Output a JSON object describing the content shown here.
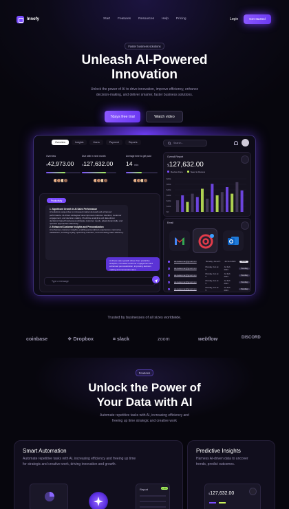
{
  "brand": {
    "name": "Innofy"
  },
  "nav": {
    "links": [
      "Start",
      "Features",
      "Resources",
      "Help",
      "Pricing"
    ],
    "login": "Login",
    "cta": "Get started"
  },
  "hero": {
    "eyebrow": "Faster business solutions",
    "title_line1": "Unleash AI-Powered",
    "title_line2": "Innovation",
    "subtitle_line1": "Unlock the power of AI to drive innovation, improve efficiency, enhance",
    "subtitle_line2": "decision-making, and deliver smarter, faster business solutions.",
    "primary_button": "7days free trial",
    "secondary_button": "Watch video"
  },
  "dashboard": {
    "tabs": [
      "Overview",
      "Insights",
      "Users",
      "Payment",
      "Reports"
    ],
    "search_placeholder": "Search...",
    "stats": [
      {
        "label": "Overview",
        "currency": "$",
        "value": "42,973.00",
        "progress": 0.55
      },
      {
        "label": "Due with in next month",
        "currency": "$",
        "value": "127,632.00",
        "progress": 0.7
      },
      {
        "label": "Average time to get paid",
        "currency": "",
        "value": "14",
        "unit": "min",
        "progress": 0.5
      }
    ],
    "chat": {
      "tag": "Productivity",
      "bot_heading1": "1. Significant Growth in AI Sales Performance",
      "bot_body1": "AI solutions surged due to increased market demand and enhanced performance. AI-driven strategies have improved customer retention, customer engagement, and decision-making. Predictive analytics and data-driven decisions helped businesses anticipate customer needs, adapt dynamically, and optimize approaches effectively.",
      "bot_heading2": "2. Enhanced Customer Insights and Personalization",
      "bot_body2": "AI enhances customer insights, enabling personalized experiences, improving satisfaction, boosting loyalty, optimizing retention, and increasing sales efficiency.",
      "user_msg": "Ai drives sales growth driven from predictive analytics, increased customer engagement and enhanced personalization, improving decision making and conversion rates.",
      "input_placeholder": "Type a message"
    },
    "report": {
      "title": "Overall Report",
      "currency": "$",
      "value": "127,632.00",
      "legend": [
        "Review Done",
        "Need to Review"
      ],
      "y_ticks": [
        "$60k",
        "$50k",
        "$40k",
        "$30k",
        "$20k",
        "$10k",
        "$0"
      ]
    },
    "email": {
      "title": "Email",
      "apps": [
        "gmail-icon",
        "mail-at-icon",
        "outlook-icon"
      ],
      "rows": [
        {
          "email": "alexsalesman@gmail.com",
          "time": "Monday, Jan at 5",
          "date": "Jul Feb 2024",
          "tag": "Done"
        },
        {
          "email": "alexsalesman@gmail.com",
          "time": "Monday, Jan at 5",
          "date": "Jul Feb 2024",
          "tag": "Pending"
        },
        {
          "email": "alexsalesman@gmail.com",
          "time": "Monday, Jan at 5",
          "date": "Jul Feb 2024",
          "tag": "Pending"
        },
        {
          "email": "alexsalesman@gmail.com",
          "time": "Monday, Jan at 5",
          "date": "Jul Feb 2024",
          "tag": "Pending"
        },
        {
          "email": "alexsalesman@gmail.com",
          "time": "Monday, Jan at 5",
          "date": "Jul Feb 2024",
          "tag": "Pending"
        }
      ]
    }
  },
  "trusted": {
    "text": "Trusted by businesses of all sizes worldwide.",
    "brands": [
      "coinbase",
      "Dropbox",
      "slack",
      "zoom",
      "webflow",
      "DISCORD"
    ]
  },
  "features_section": {
    "tag": "Features",
    "title_line1": "Unlock the Power of",
    "title_line2": "Your Data with AI",
    "subtitle_line1": "Automate repetitive tasks with AI, increasing efficiency and",
    "subtitle_line2": "freeing up time strategic and creative work"
  },
  "feature_cards": [
    {
      "title": "Smart Automation",
      "desc_line1": "Automate repetitive tasks with AI, increasing efficiency and freeing up time",
      "desc_line2": "for strategic and creative work, driving innovation and growth.",
      "mini_label": "Report",
      "mini_badge": "+5%"
    },
    {
      "title": "Predictive Insights",
      "desc_line1": "Harness AI-driven data to uncover",
      "desc_line2": "trends, predict outcomes.",
      "mini_currency": "$",
      "mini_value": "127,632.00"
    }
  ],
  "colors": {
    "accent": "#7b4dff",
    "background": "#07060d",
    "card": "#15121f"
  }
}
